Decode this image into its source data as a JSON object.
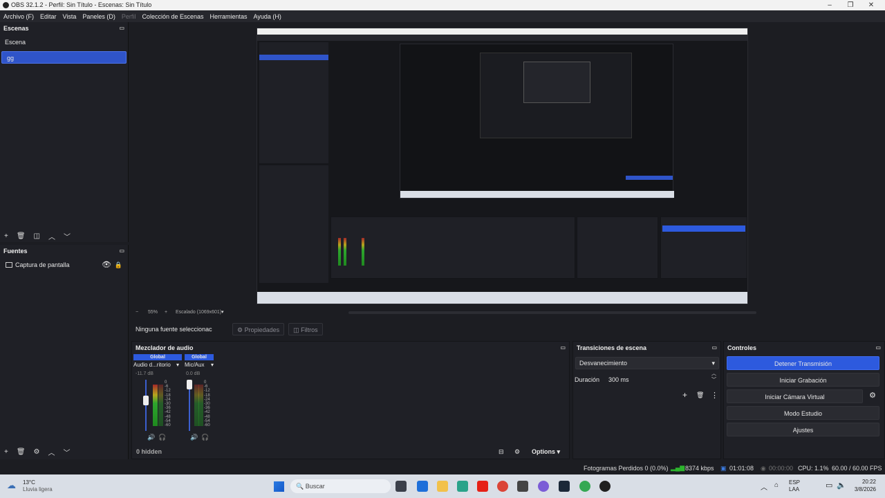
{
  "window": {
    "title": "OBS 32.1.2 - Perfil: Sin Título - Escenas: Sin Título",
    "min": "–",
    "max": "❐",
    "close": "✕"
  },
  "menu": [
    "Archivo (F)",
    "Editar",
    "Vista",
    "Paneles (D)",
    "Perfil",
    "Colección de Escenas",
    "Herramientas",
    "Ayuda (H)"
  ],
  "scenes": {
    "title": "Escenas",
    "items": [
      "Escena",
      "gg"
    ]
  },
  "sources": {
    "title": "Fuentes",
    "items": [
      {
        "label": "Captura de pantalla"
      }
    ]
  },
  "preview": {
    "zoom": "55%",
    "scaling": "Escalado (1069x601)"
  },
  "source_bar": {
    "none_selected": "Ninguna fuente seleccionac",
    "properties": "Propiedades",
    "filters": "Filtros"
  },
  "mixer": {
    "title": "Mezclador de audio",
    "channels": [
      {
        "badge": "Global",
        "name": "Audio d...ritorio",
        "db": "-11.7 dB"
      },
      {
        "badge": "Global",
        "name": "Mic/Aux",
        "db": "0.0 dB"
      }
    ],
    "scale": [
      "0",
      "-6",
      "-12",
      "-18",
      "-24",
      "-30",
      "-36",
      "-42",
      "-48",
      "-54",
      "-60"
    ],
    "hidden": "0 hidden",
    "options": "Options"
  },
  "transitions": {
    "title": "Transiciones de escena",
    "selected": "Desvanecimiento",
    "duration_label": "Duración",
    "duration_value": "300 ms"
  },
  "controls": {
    "title": "Controles",
    "stop_stream": "Detener Transmisión",
    "start_recording": "Iniciar Grabación",
    "start_virtualcam": "Iniciar Cámara Virtual",
    "studio_mode": "Modo Estudio",
    "settings": "Ajustes"
  },
  "status": {
    "dropped": "Fotogramas Perdidos 0 (0.0%)",
    "bitrate": "8374 kbps",
    "stream_time": "01:01:08",
    "rec_time": "00:00:00",
    "cpu": "CPU: 1.1%",
    "fps": "60.00 / 60.00 FPS"
  },
  "taskbar": {
    "weather_temp": "13°C",
    "weather_desc": "Lluvia ligera",
    "search": "Buscar",
    "lang": "ESP",
    "lang2": "LAA",
    "time": "20:22",
    "date": "3/8/2026"
  }
}
